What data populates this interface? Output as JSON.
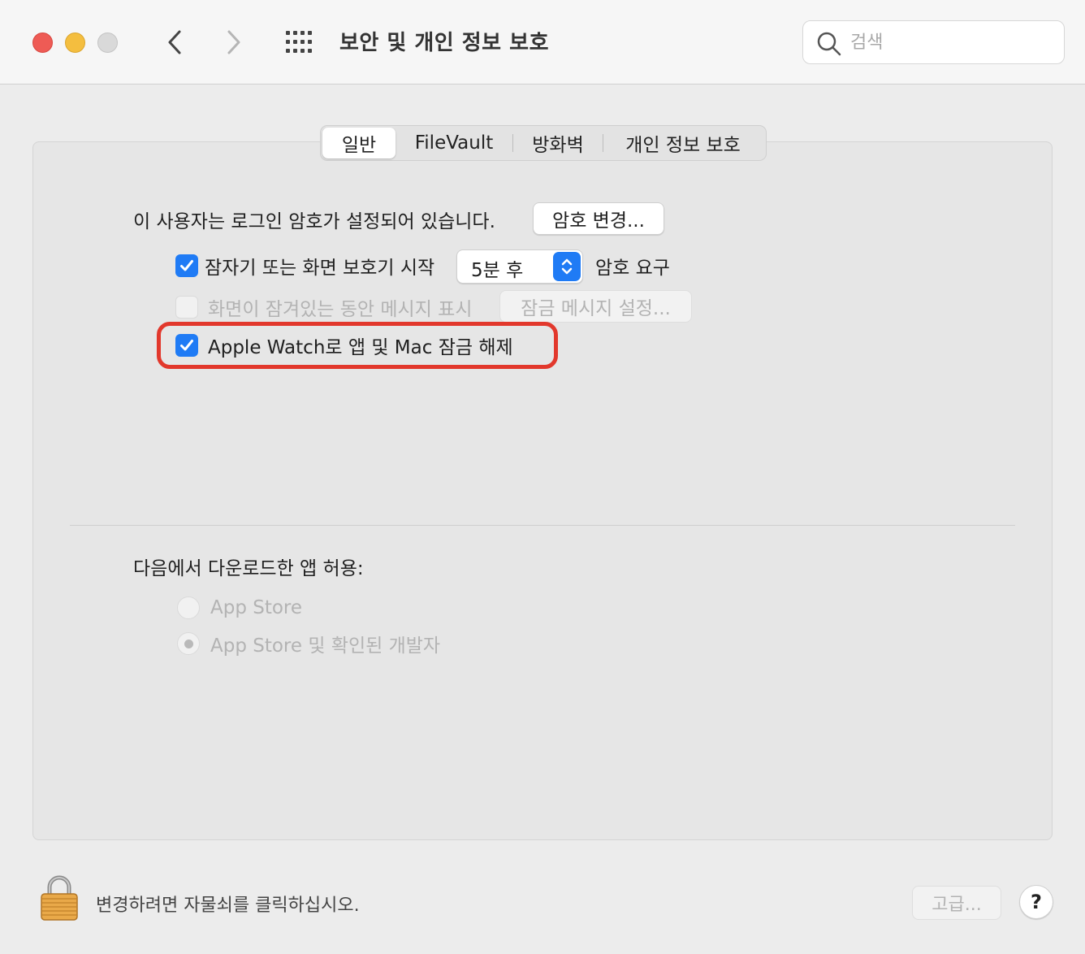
{
  "window": {
    "title": "보안 및 개인 정보 보호",
    "search_placeholder": "검색"
  },
  "tabs": [
    {
      "label": "일반",
      "active": true
    },
    {
      "label": "FileVault",
      "active": false
    },
    {
      "label": "방화벽",
      "active": false
    },
    {
      "label": "개인 정보 보호",
      "active": false
    }
  ],
  "general": {
    "login_password_text": "이 사용자는 로그인 암호가 설정되어 있습니다.",
    "change_password_button": "암호 변경...",
    "require_password": {
      "checked": true,
      "label": "잠자기 또는 화면 보호기 시작",
      "delay_value": "5분 후",
      "label_after": "암호 요구"
    },
    "show_message": {
      "checked": false,
      "enabled": false,
      "label": "화면이 잠겨있는 동안 메시지 표시",
      "button": "잠금 메시지 설정..."
    },
    "apple_watch": {
      "checked": true,
      "label": "Apple Watch로 앱 및 Mac 잠금 해제",
      "highlight_color": "#e2382c"
    }
  },
  "downloads": {
    "title": "다음에서 다운로드한 앱 허용:",
    "options": [
      {
        "label": "App Store",
        "selected": false
      },
      {
        "label": "App Store 및 확인된 개발자",
        "selected": true
      }
    ]
  },
  "footer": {
    "lock_text": "변경하려면 자물쇠를 클릭하십시오.",
    "advanced_button": "고급...",
    "help_button": "?"
  },
  "colors": {
    "accent": "#1f7bf5",
    "close": "#ee5b55",
    "minimize": "#f4be3f"
  }
}
